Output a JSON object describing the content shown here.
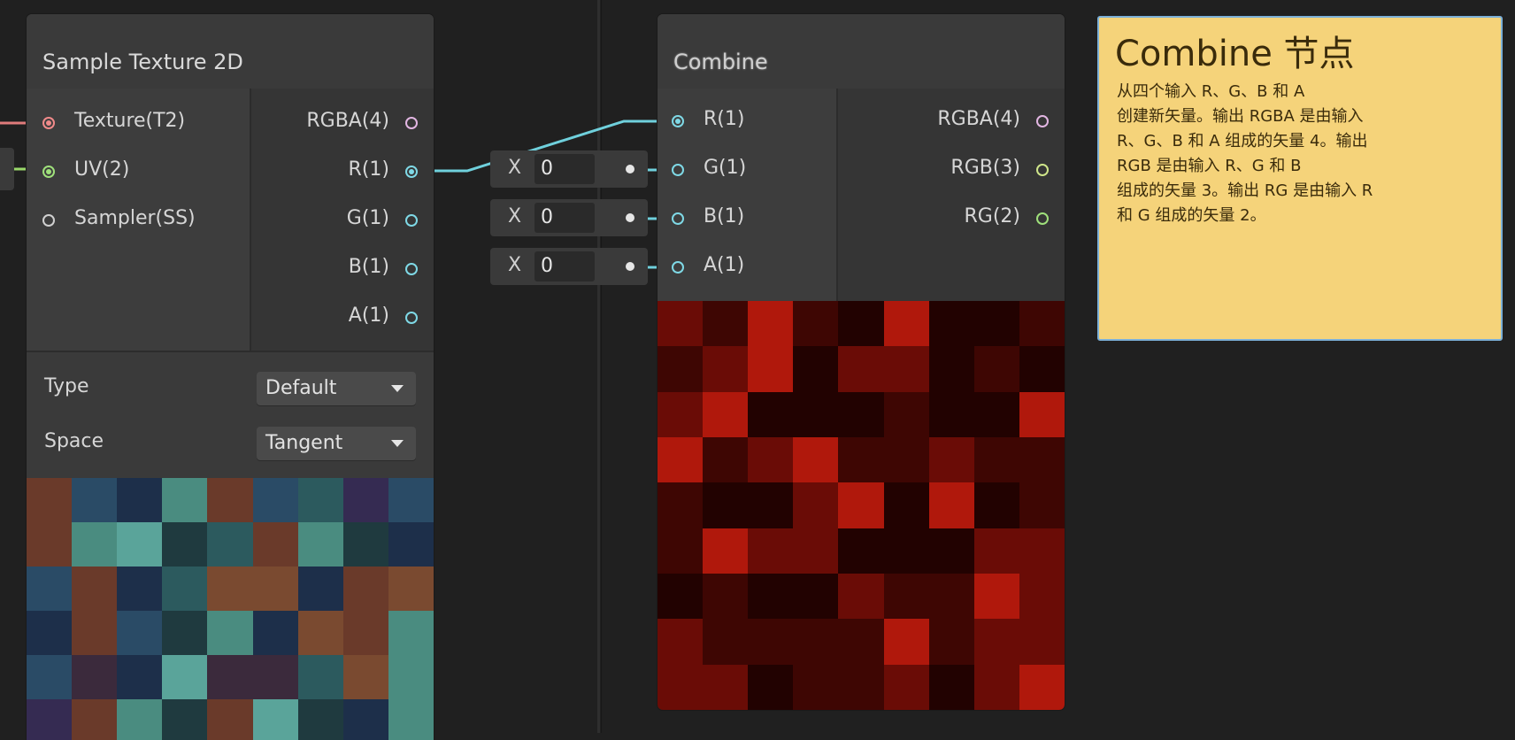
{
  "colors": {
    "background": "#202020",
    "wire_cyan": "#6fd0dc",
    "wire_red": "#e07b7b",
    "wire_green": "#9ad86a",
    "port_texture": "#f08a8a",
    "port_rgba": "#e2b6e2",
    "port_float": "#7fd9e6",
    "port_vec3": "#cfe58a",
    "port_vec2": "#9fe07b",
    "sticky_bg": "#f5d37a"
  },
  "sample_node": {
    "title": "Sample Texture 2D",
    "inputs": [
      {
        "label": "Texture(T2)",
        "color": "port_texture",
        "connected": true
      },
      {
        "label": "UV(2)",
        "color": "port_vec2",
        "connected": true
      },
      {
        "label": "Sampler(SS)",
        "color": "default",
        "connected": false
      }
    ],
    "outputs": [
      {
        "label": "RGBA(4)",
        "color": "port_rgba",
        "connected": false
      },
      {
        "label": "R(1)",
        "color": "port_float",
        "connected": true
      },
      {
        "label": "G(1)",
        "color": "port_float",
        "connected": false
      },
      {
        "label": "B(1)",
        "color": "port_float",
        "connected": false
      },
      {
        "label": "A(1)",
        "color": "port_float",
        "connected": false
      }
    ],
    "controls": {
      "type_label": "Type",
      "type_value": "Default",
      "space_label": "Space",
      "space_value": "Tangent"
    }
  },
  "inline_inputs": [
    {
      "axis": "X",
      "value": "0"
    },
    {
      "axis": "X",
      "value": "0"
    },
    {
      "axis": "X",
      "value": "0"
    }
  ],
  "combine_node": {
    "title": "Combine",
    "inputs": [
      {
        "label": "R(1)",
        "color": "port_float",
        "connected": true
      },
      {
        "label": "G(1)",
        "color": "port_float",
        "connected": true
      },
      {
        "label": "B(1)",
        "color": "port_float",
        "connected": true
      },
      {
        "label": "A(1)",
        "color": "port_float",
        "connected": true
      }
    ],
    "outputs": [
      {
        "label": "RGBA(4)",
        "color": "port_rgba"
      },
      {
        "label": "RGB(3)",
        "color": "port_vec3"
      },
      {
        "label": "RG(2)",
        "color": "port_vec2"
      }
    ]
  },
  "sticky_note": {
    "title": "Combine 节点",
    "body": "从四个输入 R、G、B 和 A\n创建新矢量。输出 RGBA 是由输入\nR、G、B 和 A 组成的矢量 4。输出\nRGB 是由输入 R、G 和 B\n组成的矢量 3。输出 RG 是由输入 R\n和 G 组成的矢量 2。"
  }
}
